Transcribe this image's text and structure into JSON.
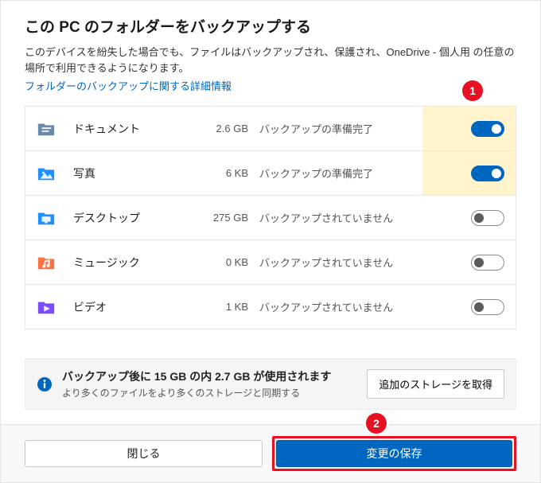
{
  "title": "この PC のフォルダーをバックアップする",
  "subtitle": "このデバイスを紛失した場合でも、ファイルはバックアップされ、保護され、OneDrive - 個人用 の任意の場所で利用できるようになります。",
  "link_text": "フォルダーのバックアップに関する詳細情報",
  "annotations": {
    "one": "1",
    "two": "2"
  },
  "folders": [
    {
      "icon": "documents-folder-icon",
      "name": "ドキュメント",
      "size": "2.6 GB",
      "status": "バックアップの準備完了",
      "toggle_on": true,
      "highlight": true
    },
    {
      "icon": "pictures-folder-icon",
      "name": "写真",
      "size": "6 KB",
      "status": "バックアップの準備完了",
      "toggle_on": true,
      "highlight": true
    },
    {
      "icon": "desktop-folder-icon",
      "name": "デスクトップ",
      "size": "275 GB",
      "status": "バックアップされていません",
      "toggle_on": false,
      "highlight": false
    },
    {
      "icon": "music-folder-icon",
      "name": "ミュージック",
      "size": "0 KB",
      "status": "バックアップされていません",
      "toggle_on": false,
      "highlight": false
    },
    {
      "icon": "videos-folder-icon",
      "name": "ビデオ",
      "size": "1 KB",
      "status": "バックアップされていません",
      "toggle_on": false,
      "highlight": false
    }
  ],
  "info": {
    "title": "バックアップ後に 15 GB の内 2.7 GB が使用されます",
    "subtitle": "より多くのファイルをより多くのストレージと同期する",
    "button": "追加のストレージを取得"
  },
  "footer": {
    "close": "閉じる",
    "save": "変更の保存"
  },
  "icon_colors": {
    "documents": "#6a8aa8",
    "pictures": "#1f91ff",
    "desktop": "#1f91ff",
    "music": "#ff7043",
    "videos": "#7b4dff",
    "info": "#0067c0"
  }
}
